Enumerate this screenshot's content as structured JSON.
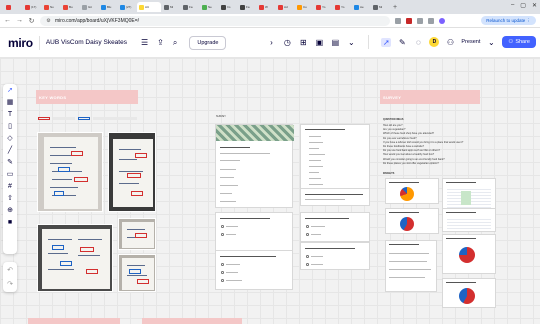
{
  "browser": {
    "tabs": [
      {
        "label": "",
        "color": "#e53935"
      },
      {
        "label": "(17)",
        "color": "#e53935"
      },
      {
        "label": "No",
        "color": "#ea4335"
      },
      {
        "label": "Bu",
        "color": "#ea4335"
      },
      {
        "label": "Git",
        "color": "#9aa0a6"
      },
      {
        "label": "Blu",
        "color": "#1e88e5"
      },
      {
        "label": "(27)",
        "color": "#1e88e5"
      },
      {
        "label": "AU",
        "color": "#fdd835",
        "active": true
      },
      {
        "label": "Mi",
        "color": "#5f6368"
      },
      {
        "label": "Fa",
        "color": "#5f6368"
      },
      {
        "label": "Ne",
        "color": "#4caf50"
      },
      {
        "label": "Im",
        "color": "#424242"
      },
      {
        "label": "Fa",
        "color": "#424242"
      },
      {
        "label": "W",
        "color": "#e53935"
      },
      {
        "label": "Ad",
        "color": "#e53935"
      },
      {
        "label": "Co",
        "color": "#ff9800"
      },
      {
        "label": "Yo",
        "color": "#e53935"
      },
      {
        "label": "Yo",
        "color": "#e53935"
      },
      {
        "label": "Ae",
        "color": "#1e88e5"
      },
      {
        "label": "Mi",
        "color": "#5f6368"
      }
    ],
    "new_tab": "+",
    "url": "miro.com/app/board/uXjVKF3MQ0E=/",
    "relaunch": "Relaunch to update",
    "relaunch_more": "⋮"
  },
  "miro": {
    "logo": "miro",
    "board_name": "AUB VisCom Daisy Skeates",
    "upgrade": "Upgrade",
    "present": "Present",
    "share": "Share",
    "avatar": "D",
    "notif_count": "1"
  },
  "board": {
    "frame1_title": "KEY WORDS",
    "frame2_title": "SURVEY",
    "survey_label": "SURVEY",
    "question_ideas_label": "QUESTION IDEAS",
    "insights_label": "INSIGHTS",
    "question_ideas": [
      "How old are you?",
      "Are you vegetarian?",
      "Which of these food shop have you attended?",
      "Do you ever eat leftover food?",
      "If you have a leftover dish would you bring it to a place that would use it?",
      "Do these foodbanks have a website?",
      "Do you use food bank apps such as Olio or others?",
      "How would you feel about a healthy food box?",
      "Would you consider going to an eco-friendly food bank?",
      "Do these places you visit offer vegetarian options?"
    ]
  },
  "colors": {
    "accent": "#4262ff",
    "header_pink": "#f4c7c7",
    "annot_red": "#d32f2f",
    "annot_blue": "#1e63c4"
  }
}
